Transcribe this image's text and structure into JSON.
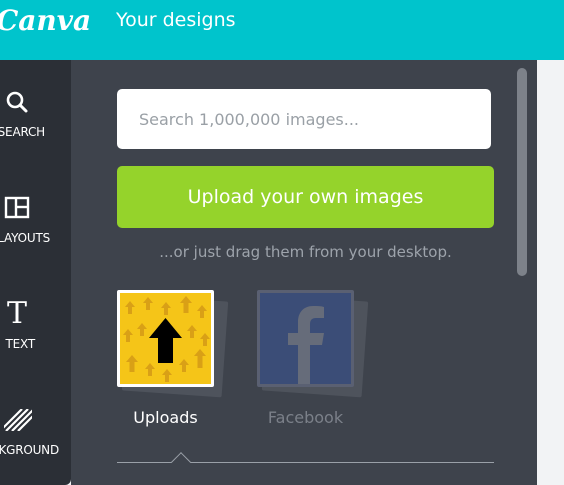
{
  "header": {
    "logo": "Canva",
    "title": "Your designs"
  },
  "sidebar": {
    "items": [
      {
        "label": "SEARCH",
        "icon": "search-icon"
      },
      {
        "label": "LAYOUTS",
        "icon": "layouts-icon"
      },
      {
        "label": "TEXT",
        "icon": "text-icon"
      },
      {
        "label": "BKGROUND",
        "icon": "background-icon"
      }
    ]
  },
  "panel": {
    "search_placeholder": "Search 1,000,000 images...",
    "upload_label": "Upload your own images",
    "drag_hint": "...or just drag them from your desktop.",
    "sources": [
      {
        "label": "Uploads",
        "active": true
      },
      {
        "label": "Facebook",
        "active": false
      }
    ]
  },
  "colors": {
    "topbar": "#00c4cc",
    "upload_button": "#95d32b",
    "panel_bg": "#3e434c",
    "rail_bg": "#2b2f36",
    "uploads_tile": "#f5c518",
    "facebook_tile": "#3b4d77"
  }
}
